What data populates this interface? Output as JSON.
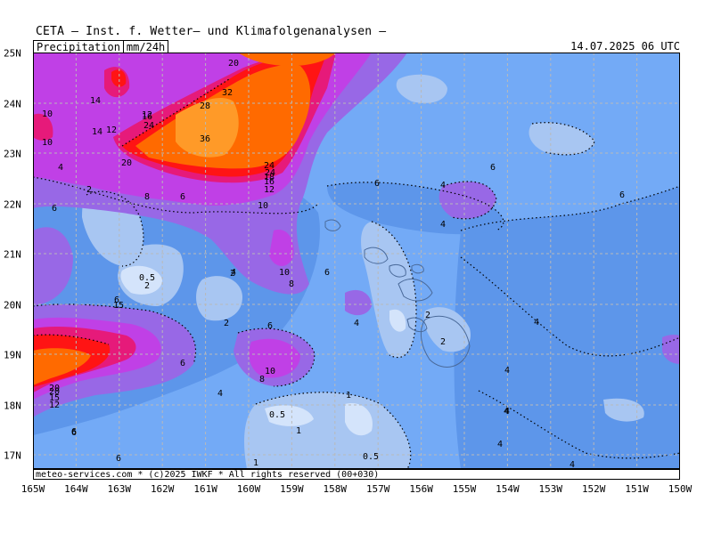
{
  "header": {
    "title": "CETA — Inst. f. Wetter— und Klimafolgenanalysen —",
    "parameter": "Precipitation",
    "unit": "mm/24h",
    "datetime": "14.07.2025  06 UTC"
  },
  "footer": {
    "credit": "meteo-services.com * (c)2025 IWKF * All rights reserved (00+030)"
  },
  "axes": {
    "lon_labels": [
      "165W",
      "164W",
      "163W",
      "162W",
      "161W",
      "160W",
      "159W",
      "158W",
      "157W",
      "156W",
      "155W",
      "154W",
      "153W",
      "152W",
      "151W",
      "150W"
    ],
    "lat_labels": [
      "25N",
      "24N",
      "23N",
      "22N",
      "21N",
      "20N",
      "19N",
      "18N",
      "17N"
    ]
  },
  "colors": {
    "ocean_light": "#73aaf6",
    "dry_light": "#aac9f3",
    "very_dry": "#d6e6fb",
    "mid_blue": "#5891e8",
    "violet": "#9a6ae8",
    "magenta": "#c040e8",
    "pink": "#e8107a",
    "red": "#ff1010",
    "orange": "#ff6a00",
    "light_orange": "#ff9a20"
  },
  "contour_labels": [
    "20",
    "32",
    "28",
    "36",
    "24",
    "24",
    "14",
    "12",
    "16",
    "14",
    "12",
    "18",
    "10",
    "10",
    "20",
    "24",
    "20",
    "16",
    "12",
    "4",
    "2",
    "6",
    "8",
    "6",
    "10",
    "6",
    "4",
    "6",
    "6",
    "4",
    "2",
    "0.5",
    "2",
    "4",
    "10",
    "6",
    "8",
    "6",
    "15",
    "2",
    "6",
    "4",
    "2",
    "2",
    "4",
    "6",
    "10",
    "8",
    "6",
    "4",
    "20",
    "15",
    "12",
    "1",
    "0.5",
    "1",
    "6",
    "6",
    "4",
    "1",
    "0.5",
    "4",
    "4",
    "4",
    "4"
  ]
}
